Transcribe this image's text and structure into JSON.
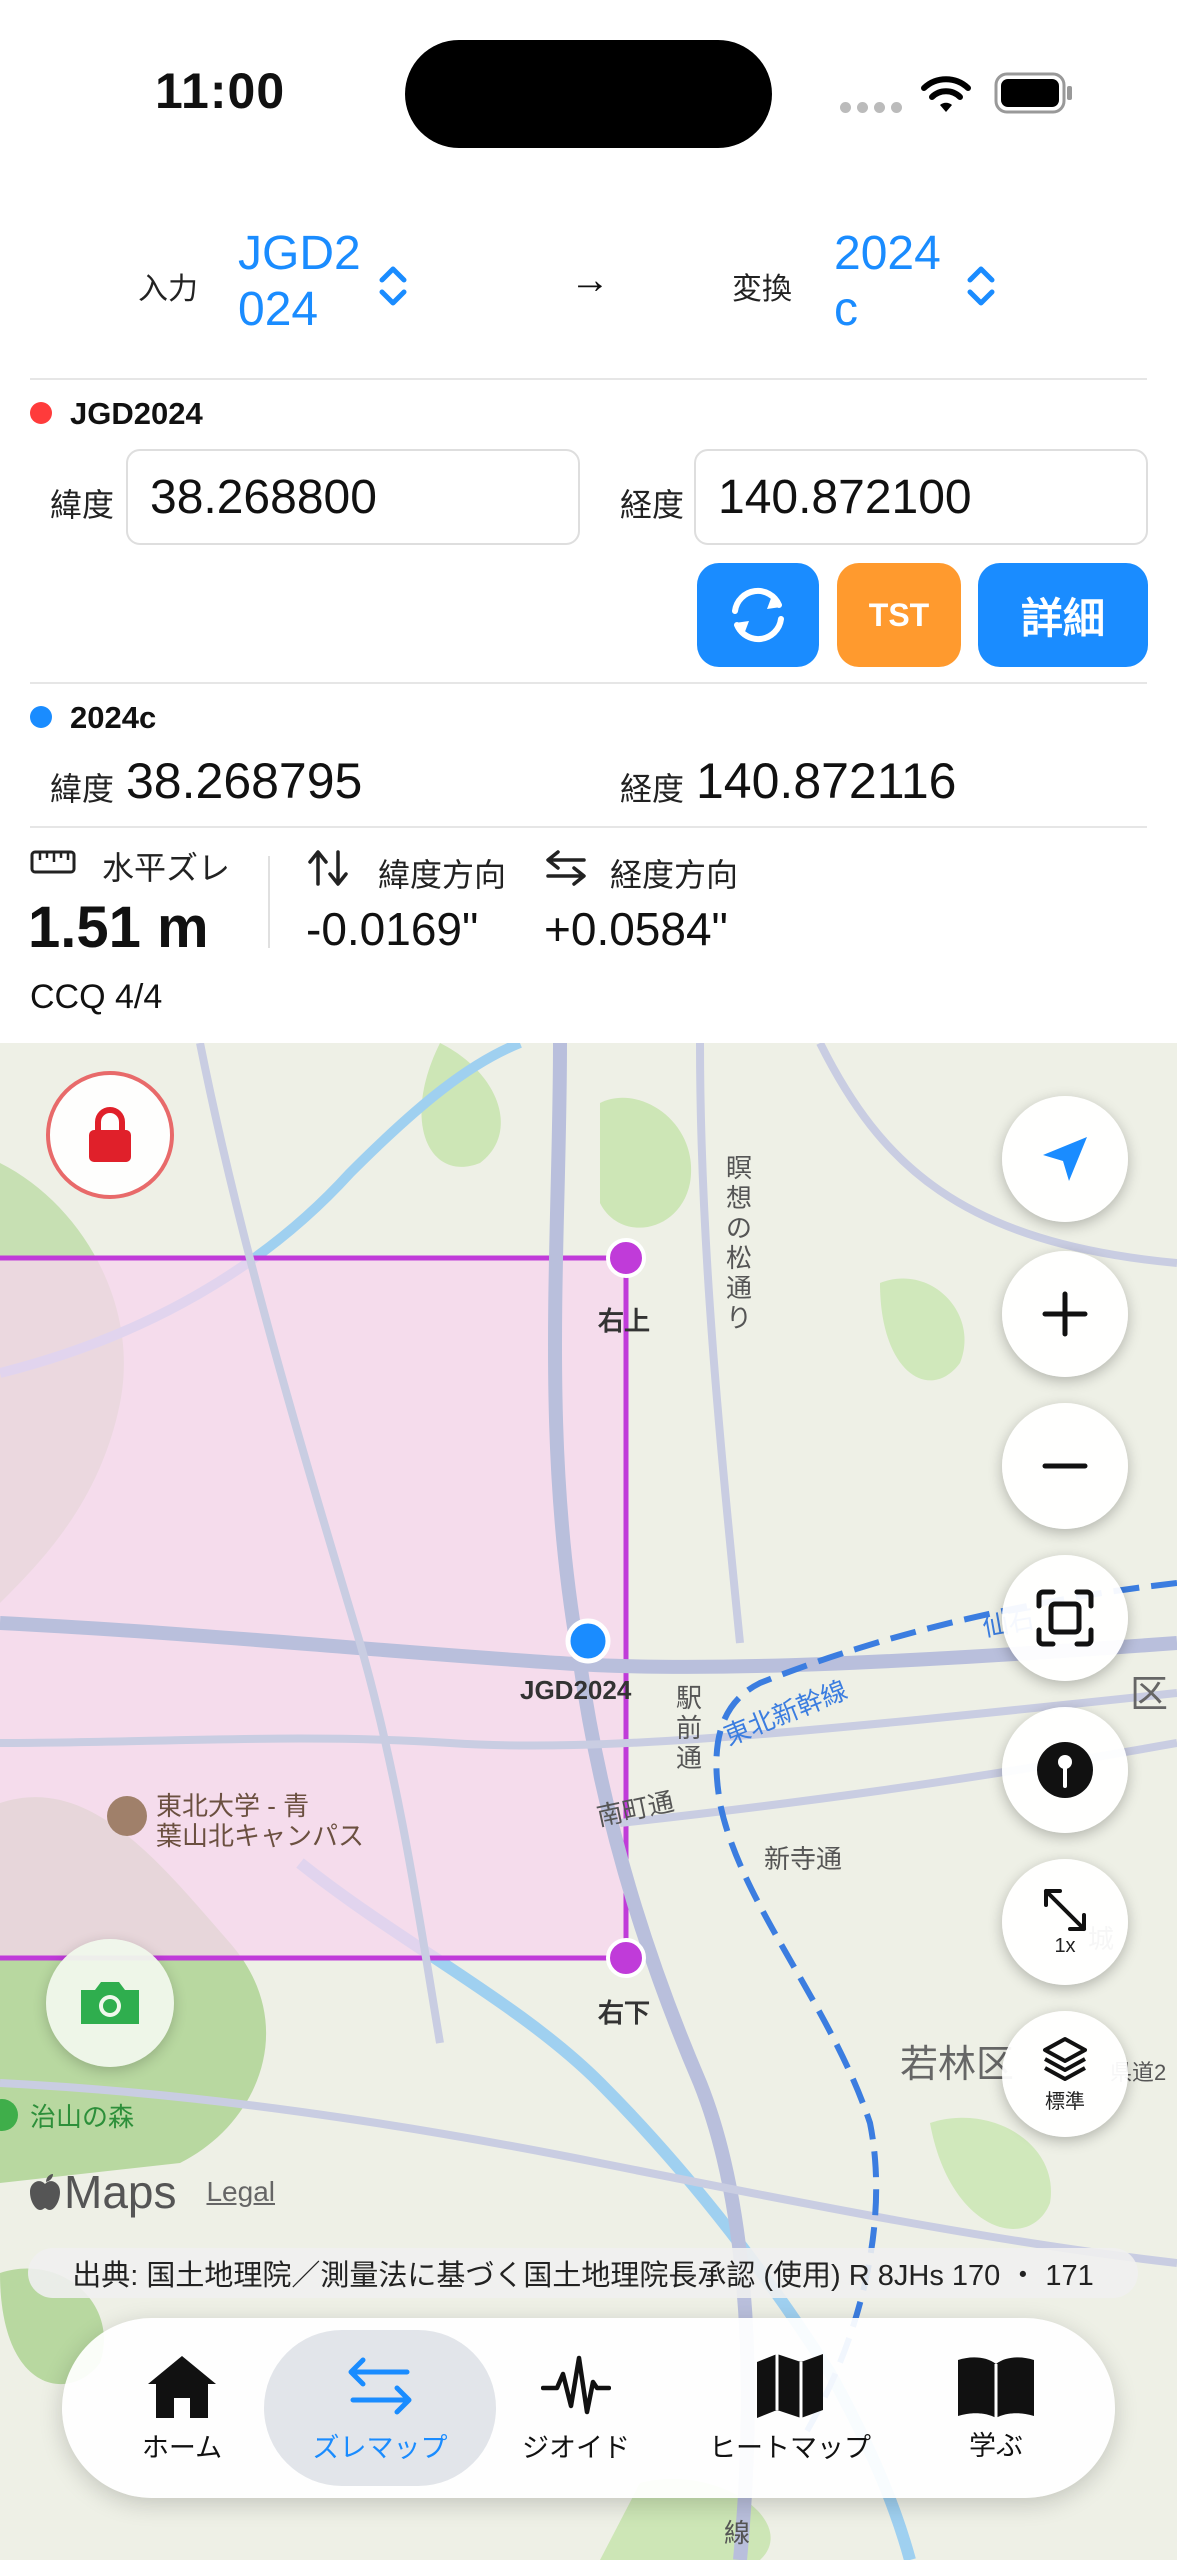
{
  "status": {
    "time": "11:00"
  },
  "selector": {
    "input_label": "入力",
    "input_value_line1": "JGD2",
    "input_value_line2": "024",
    "arrow": "→",
    "output_label": "変換",
    "output_value_line1": "2024",
    "output_value_line2": "c"
  },
  "source": {
    "title": "JGD2024",
    "dot_color": "#ff3b3b",
    "lat_label": "緯度",
    "lat_value": "38.268800",
    "lon_label": "経度",
    "lon_value": "140.872100",
    "buttons": {
      "convert_icon": "refresh-icon",
      "tst": "TST",
      "detail": "詳細"
    }
  },
  "result": {
    "title": "2024c",
    "dot_color": "#1a8cff",
    "lat_label": "緯度",
    "lat_value": "38.268795",
    "lon_label": "経度",
    "lon_value": "140.872116"
  },
  "stats": {
    "horizontal_label": "水平ズレ",
    "horizontal_value": "1.51 m",
    "lat_dir_label": "緯度方向",
    "lat_dir_value": "-0.0169\"",
    "lon_dir_label": "経度方向",
    "lon_dir_value": "+0.0584\"",
    "ccq": "CCQ 4/4"
  },
  "map": {
    "corner_tr": "右上",
    "corner_br": "右下",
    "point_label": "JGD2024",
    "place_labels": {
      "university": "東北大学 - 青\n葉山北キャンパス",
      "meisou": "瞑想の松通り",
      "tohoku_shinkansen": "東北新幹線",
      "sendai_ishi": "仙石",
      "ekimae": "駅前通",
      "minamimachi": "南町通",
      "shinteradori": "新寺通",
      "wakabayashi": "若林区",
      "ward": "区",
      "jiyama": "治山の森",
      "kendo": "県道2",
      "jo": "城",
      "sen": "線"
    },
    "maps_brand": "Maps",
    "legal": "Legal",
    "zoom_label": "1x",
    "layer_label": "標準",
    "credit": "出典: 国土地理院／測量法に基づく国土地理院長承認 (使用) R 8JHs 170 ・ 171"
  },
  "tabs": [
    {
      "label": "ホーム",
      "icon": "house-icon"
    },
    {
      "label": "ズレマップ",
      "icon": "arrows-swap-icon"
    },
    {
      "label": "ジオイド",
      "icon": "waveform-icon"
    },
    {
      "label": "ヒートマップ",
      "icon": "map-icon"
    },
    {
      "label": "学ぶ",
      "icon": "book-icon"
    }
  ],
  "colors": {
    "accent": "#1a8cff",
    "tst": "#ff9a2e",
    "region_fill": "#f7d6ee",
    "region_stroke": "#c03bd9"
  }
}
